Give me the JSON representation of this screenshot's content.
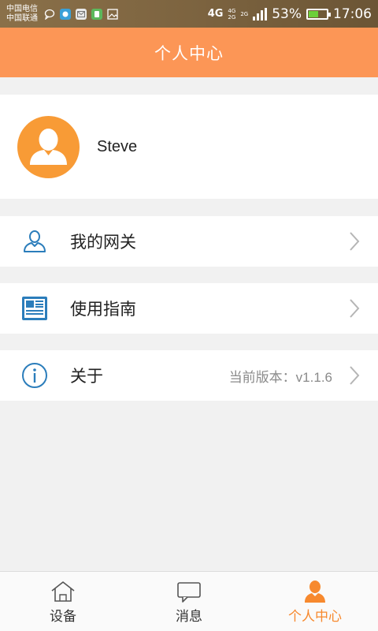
{
  "status_bar": {
    "carrier1": "中国电信",
    "carrier2": "中国联通",
    "network1": "4G",
    "network2_top": "4G",
    "network2_bottom": "2G",
    "network3": "2G",
    "battery_percent": "53%",
    "battery_level": 0.53,
    "time": "17:06"
  },
  "header": {
    "title": "个人中心"
  },
  "profile": {
    "username": "Steve"
  },
  "menu": {
    "gateway_label": "我的网关",
    "guide_label": "使用指南",
    "about_label": "关于",
    "version_text": "当前版本：v1.1.6"
  },
  "bottom_nav": {
    "devices_label": "设备",
    "messages_label": "消息",
    "profile_label": "个人中心",
    "active_color": "#f7892e"
  },
  "colors": {
    "header_bg": "#fc9656",
    "avatar_bg": "#f89b36",
    "icon_blue": "#2b7dbb"
  }
}
